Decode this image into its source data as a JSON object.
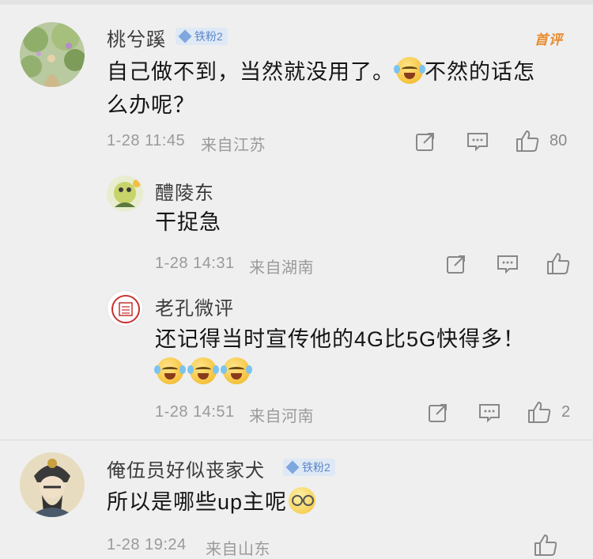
{
  "comments": [
    {
      "username": "桃兮蹊",
      "badge": "铁粉2",
      "tag": "首评",
      "text": "自己做不到，当然就没用了。😂不然的话怎么办呢？",
      "text_line1": "自己做不到，当然就没用了。",
      "text_line1b": "不然的话怎",
      "text_line2": "么办呢？",
      "time": "1-28 11:45",
      "location": "来自江苏",
      "likes": "80"
    },
    {
      "username": "醴陵东",
      "text": "干捉急",
      "time": "1-28 14:31",
      "location": "来自湖南",
      "likes": ""
    },
    {
      "username": "老孔微评",
      "text": "还记得当时宣传他的4G比5G快得多！",
      "avatar_seal": "老孔微评",
      "time": "1-28 14:51",
      "location": "来自河南",
      "likes": "2"
    },
    {
      "username": "俺伍员好似丧家犬",
      "badge": "铁粉2",
      "text": "所以是哪些up主呢",
      "time": "1-28 19:24",
      "location": "来自山东",
      "likes": ""
    }
  ],
  "icons": {
    "share": "share-icon",
    "comment": "comment-icon",
    "like": "thumbs-up-icon",
    "emoji_laugh_cry": "laugh-cry-emoji",
    "emoji_glasses": "glasses-emoji"
  },
  "colors": {
    "badge_text": "#5b86c7",
    "tag": "#e98a2c",
    "meta": "#9a9a9a"
  }
}
